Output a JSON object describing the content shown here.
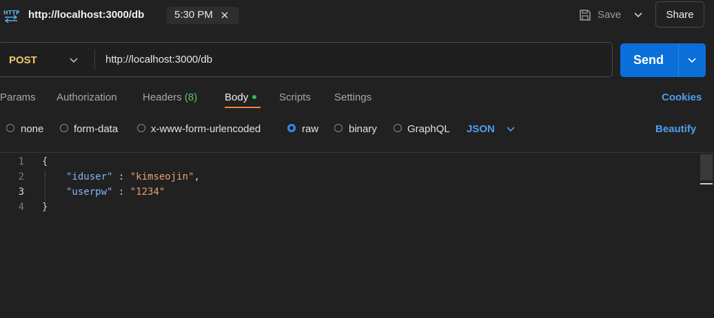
{
  "header": {
    "request_name": "http://localhost:3000/db",
    "tab_time": "5:30 PM",
    "save_label": "Save",
    "share_label": "Share",
    "icons": {
      "protocol": "http-icon",
      "close": "close-icon",
      "save": "save-icon",
      "caret": "chevron-down-icon"
    }
  },
  "request": {
    "method": "POST",
    "url": "http://localhost:3000/db",
    "send_label": "Send"
  },
  "tabs": [
    {
      "label": "Params"
    },
    {
      "label": "Authorization"
    },
    {
      "label": "Headers",
      "count": "(8)"
    },
    {
      "label": "Body",
      "active": true
    },
    {
      "label": "Scripts"
    },
    {
      "label": "Settings"
    }
  ],
  "cookies_label": "Cookies",
  "body_options": {
    "modes": [
      "none",
      "form-data",
      "x-www-form-urlencoded",
      "raw",
      "binary",
      "GraphQL"
    ],
    "selected": "raw",
    "language": "JSON",
    "beautify_label": "Beautify"
  },
  "editor": {
    "line_numbers": [
      "1",
      "2",
      "3",
      "4"
    ],
    "open_brace": "{",
    "close_brace": "}",
    "fields": [
      {
        "key": "\"iduser\"",
        "value": "\"kimseojin\"",
        "trail": ","
      },
      {
        "key": "\"userpw\"",
        "value": "\"1234\"",
        "trail": ""
      }
    ]
  },
  "colors": {
    "accent_blue": "#0b6fd9",
    "link_blue": "#4f9ef0",
    "method_post": "#f3c96b",
    "active_tab_underline": "#f08a3a",
    "status_green": "#28c15a"
  }
}
